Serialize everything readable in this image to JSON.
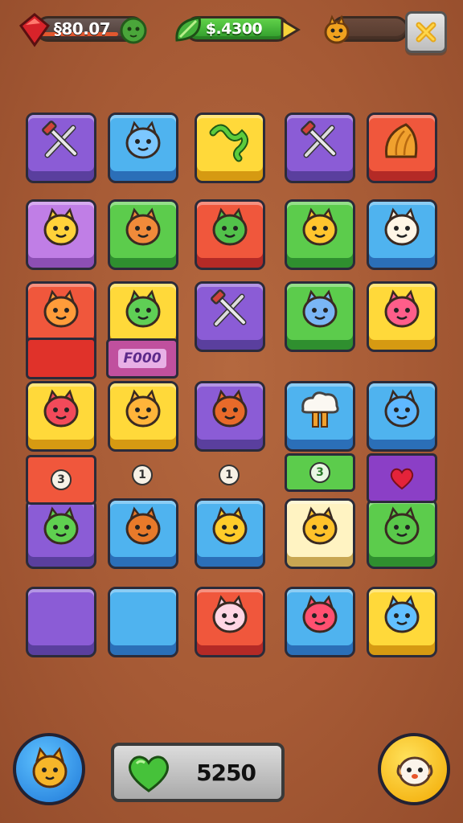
{
  "hud": {
    "ruby_value": "§80.07",
    "cash_value": "$.4300",
    "close_icon": "close-x-icon"
  },
  "board": {
    "tiles": [
      {
        "color": "purple",
        "icon": "hammer-crossed-icon"
      },
      {
        "color": "blue",
        "icon": "fish-icon"
      },
      {
        "color": "yellow",
        "icon": "green-snake-icon"
      },
      {
        "color": "purple",
        "icon": "crossed-tools-icon"
      },
      {
        "color": "red",
        "icon": "orange-shell-icon"
      },
      {
        "color": "lilac",
        "icon": "yellow-cat-icon"
      },
      {
        "color": "green",
        "icon": "orange-dragon-icon"
      },
      {
        "color": "red",
        "icon": "green-cactus-icon"
      },
      {
        "color": "green",
        "icon": "yellow-fox-icon"
      },
      {
        "color": "blue",
        "icon": "sun-face-icon"
      },
      {
        "color": "red",
        "icon": "orange-bird-icon"
      },
      {
        "color": "yellow",
        "icon": "green-blob-icon"
      },
      {
        "color": "purple",
        "icon": "crossed-swords-icon"
      },
      {
        "color": "green",
        "icon": "blue-bat-icon"
      },
      {
        "color": "yellow",
        "icon": "pink-jelly-icon"
      },
      {
        "color": "yellow",
        "icon": "red-bug-icon"
      },
      {
        "color": "yellow",
        "icon": "orange-star-icon"
      },
      {
        "color": "purple",
        "icon": "orange-fox-icon"
      },
      {
        "color": "blue",
        "icon": "mushroom-cloud-icon"
      },
      {
        "color": "blue",
        "icon": "blue-cat-icon"
      },
      {
        "color": "purple",
        "icon": "green-frog-icon"
      },
      {
        "color": "blue",
        "icon": "orange-fox-head-icon"
      },
      {
        "color": "blue",
        "icon": "yellow-bird-icon"
      },
      {
        "color": "cream",
        "icon": "yellow-fox2-icon"
      },
      {
        "color": "green",
        "icon": "green-cat-icon"
      },
      {
        "color": "purple",
        "icon": ""
      },
      {
        "color": "blue",
        "icon": ""
      },
      {
        "color": "red",
        "icon": "pink-ghost-icon"
      },
      {
        "color": "blue",
        "icon": "red-jelly-icon"
      },
      {
        "color": "yellow",
        "icon": "blue-puff-icon"
      }
    ],
    "tag_label": "F000",
    "tokens": [
      "3",
      "1",
      "1",
      "3"
    ]
  },
  "bottom": {
    "score_value": "5250",
    "left_button_icon": "orange-cat-icon",
    "right_button_icon": "white-puppy-icon",
    "score_icon": "green-heart-icon"
  }
}
